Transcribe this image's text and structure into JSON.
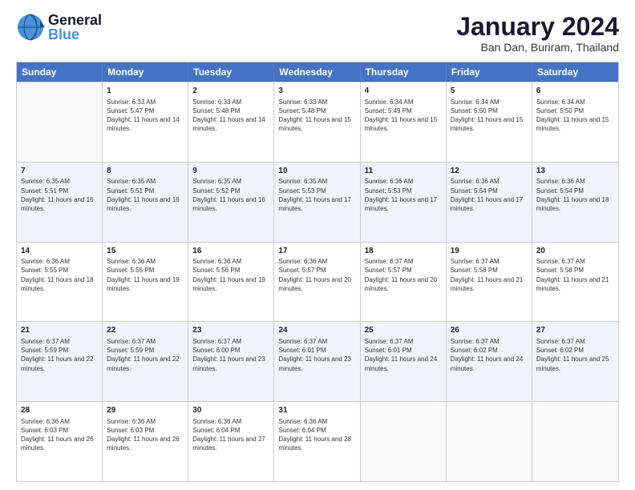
{
  "header": {
    "logo_general": "General",
    "logo_blue": "Blue",
    "month_year": "January 2024",
    "location": "Ban Dan, Buriram, Thailand"
  },
  "calendar": {
    "days": [
      "Sunday",
      "Monday",
      "Tuesday",
      "Wednesday",
      "Thursday",
      "Friday",
      "Saturday"
    ],
    "weeks": [
      [
        {
          "day": "",
          "sunrise": "",
          "sunset": "",
          "daylight": ""
        },
        {
          "day": "1",
          "sunrise": "Sunrise: 6:33 AM",
          "sunset": "Sunset: 5:47 PM",
          "daylight": "Daylight: 11 hours and 14 minutes."
        },
        {
          "day": "2",
          "sunrise": "Sunrise: 6:33 AM",
          "sunset": "Sunset: 5:48 PM",
          "daylight": "Daylight: 11 hours and 14 minutes."
        },
        {
          "day": "3",
          "sunrise": "Sunrise: 6:33 AM",
          "sunset": "Sunset: 5:48 PM",
          "daylight": "Daylight: 11 hours and 15 minutes."
        },
        {
          "day": "4",
          "sunrise": "Sunrise: 6:34 AM",
          "sunset": "Sunset: 5:49 PM",
          "daylight": "Daylight: 11 hours and 15 minutes."
        },
        {
          "day": "5",
          "sunrise": "Sunrise: 6:34 AM",
          "sunset": "Sunset: 5:50 PM",
          "daylight": "Daylight: 11 hours and 15 minutes."
        },
        {
          "day": "6",
          "sunrise": "Sunrise: 6:34 AM",
          "sunset": "Sunset: 5:50 PM",
          "daylight": "Daylight: 11 hours and 15 minutes."
        }
      ],
      [
        {
          "day": "7",
          "sunrise": "Sunrise: 6:35 AM",
          "sunset": "Sunset: 5:51 PM",
          "daylight": "Daylight: 11 hours and 16 minutes."
        },
        {
          "day": "8",
          "sunrise": "Sunrise: 6:35 AM",
          "sunset": "Sunset: 5:51 PM",
          "daylight": "Daylight: 11 hours and 16 minutes."
        },
        {
          "day": "9",
          "sunrise": "Sunrise: 6:35 AM",
          "sunset": "Sunset: 5:52 PM",
          "daylight": "Daylight: 11 hours and 16 minutes."
        },
        {
          "day": "10",
          "sunrise": "Sunrise: 6:35 AM",
          "sunset": "Sunset: 5:53 PM",
          "daylight": "Daylight: 11 hours and 17 minutes."
        },
        {
          "day": "11",
          "sunrise": "Sunrise: 6:36 AM",
          "sunset": "Sunset: 5:53 PM",
          "daylight": "Daylight: 11 hours and 17 minutes."
        },
        {
          "day": "12",
          "sunrise": "Sunrise: 6:36 AM",
          "sunset": "Sunset: 5:54 PM",
          "daylight": "Daylight: 11 hours and 17 minutes."
        },
        {
          "day": "13",
          "sunrise": "Sunrise: 6:36 AM",
          "sunset": "Sunset: 5:54 PM",
          "daylight": "Daylight: 11 hours and 18 minutes."
        }
      ],
      [
        {
          "day": "14",
          "sunrise": "Sunrise: 6:36 AM",
          "sunset": "Sunset: 5:55 PM",
          "daylight": "Daylight: 11 hours and 18 minutes."
        },
        {
          "day": "15",
          "sunrise": "Sunrise: 6:36 AM",
          "sunset": "Sunset: 5:55 PM",
          "daylight": "Daylight: 11 hours and 19 minutes."
        },
        {
          "day": "16",
          "sunrise": "Sunrise: 6:36 AM",
          "sunset": "Sunset: 5:56 PM",
          "daylight": "Daylight: 11 hours and 19 minutes."
        },
        {
          "day": "17",
          "sunrise": "Sunrise: 6:36 AM",
          "sunset": "Sunset: 5:57 PM",
          "daylight": "Daylight: 11 hours and 20 minutes."
        },
        {
          "day": "18",
          "sunrise": "Sunrise: 6:37 AM",
          "sunset": "Sunset: 5:57 PM",
          "daylight": "Daylight: 11 hours and 20 minutes."
        },
        {
          "day": "19",
          "sunrise": "Sunrise: 6:37 AM",
          "sunset": "Sunset: 5:58 PM",
          "daylight": "Daylight: 11 hours and 21 minutes."
        },
        {
          "day": "20",
          "sunrise": "Sunrise: 6:37 AM",
          "sunset": "Sunset: 5:58 PM",
          "daylight": "Daylight: 11 hours and 21 minutes."
        }
      ],
      [
        {
          "day": "21",
          "sunrise": "Sunrise: 6:37 AM",
          "sunset": "Sunset: 5:59 PM",
          "daylight": "Daylight: 11 hours and 22 minutes."
        },
        {
          "day": "22",
          "sunrise": "Sunrise: 6:37 AM",
          "sunset": "Sunset: 5:59 PM",
          "daylight": "Daylight: 11 hours and 22 minutes."
        },
        {
          "day": "23",
          "sunrise": "Sunrise: 6:37 AM",
          "sunset": "Sunset: 6:00 PM",
          "daylight": "Daylight: 11 hours and 23 minutes."
        },
        {
          "day": "24",
          "sunrise": "Sunrise: 6:37 AM",
          "sunset": "Sunset: 6:01 PM",
          "daylight": "Daylight: 11 hours and 23 minutes."
        },
        {
          "day": "25",
          "sunrise": "Sunrise: 6:37 AM",
          "sunset": "Sunset: 6:01 PM",
          "daylight": "Daylight: 11 hours and 24 minutes."
        },
        {
          "day": "26",
          "sunrise": "Sunrise: 6:37 AM",
          "sunset": "Sunset: 6:02 PM",
          "daylight": "Daylight: 11 hours and 24 minutes."
        },
        {
          "day": "27",
          "sunrise": "Sunrise: 6:37 AM",
          "sunset": "Sunset: 6:02 PM",
          "daylight": "Daylight: 11 hours and 25 minutes."
        }
      ],
      [
        {
          "day": "28",
          "sunrise": "Sunrise: 6:36 AM",
          "sunset": "Sunset: 6:03 PM",
          "daylight": "Daylight: 11 hours and 26 minutes."
        },
        {
          "day": "29",
          "sunrise": "Sunrise: 6:36 AM",
          "sunset": "Sunset: 6:03 PM",
          "daylight": "Daylight: 11 hours and 26 minutes."
        },
        {
          "day": "30",
          "sunrise": "Sunrise: 6:36 AM",
          "sunset": "Sunset: 6:04 PM",
          "daylight": "Daylight: 11 hours and 27 minutes."
        },
        {
          "day": "31",
          "sunrise": "Sunrise: 6:36 AM",
          "sunset": "Sunset: 6:04 PM",
          "daylight": "Daylight: 11 hours and 28 minutes."
        },
        {
          "day": "",
          "sunrise": "",
          "sunset": "",
          "daylight": ""
        },
        {
          "day": "",
          "sunrise": "",
          "sunset": "",
          "daylight": ""
        },
        {
          "day": "",
          "sunrise": "",
          "sunset": "",
          "daylight": ""
        }
      ]
    ]
  }
}
